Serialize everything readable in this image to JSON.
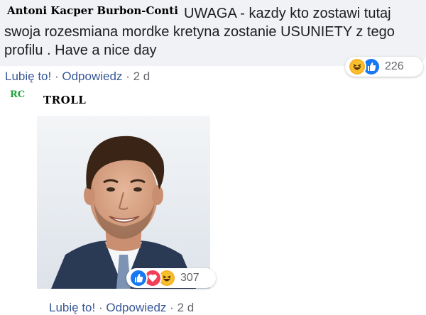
{
  "comment": {
    "author": "Antoni Kacper Burbon-Conti",
    "text": "UWAGA - kazdy kto zostawi tutaj swoja rozesmiana mordke kretyna zostanie USUNIETY z tego profilu . Have a nice day",
    "reactions": {
      "icons": [
        "laughing-emoji-icon",
        "like-icon"
      ],
      "count": "226"
    },
    "actions": {
      "like": "Lubię to!",
      "reply": "Odpowiedz",
      "separator": "·",
      "time": "2 d"
    }
  },
  "reply": {
    "badge": "RC",
    "caption": "TROLL",
    "image": {
      "subject": "portrait-photo"
    },
    "reactions": {
      "icons": [
        "like-icon",
        "heart-icon",
        "laughing-emoji-icon"
      ],
      "count": "307"
    },
    "actions": {
      "like": "Lubię to!",
      "reply": "Odpowiedz",
      "separator": "·",
      "time": "2 d"
    }
  },
  "colors": {
    "bubble": "#f0f2f5",
    "link": "#385898",
    "meta": "#65676b",
    "like_blue": "#1877f2",
    "love_red": "#f33e58",
    "haha_yellow": "#f7b125",
    "badge_green": "#1fa53a"
  }
}
